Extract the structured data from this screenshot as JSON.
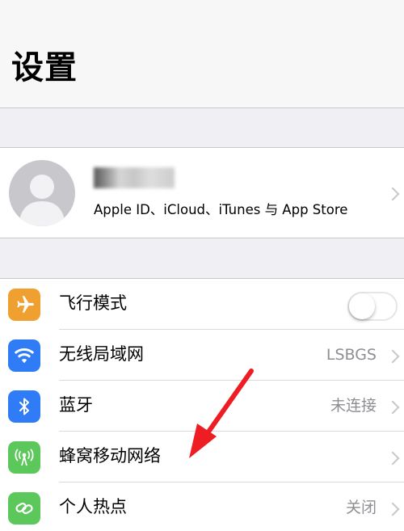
{
  "header": {
    "title": "设置"
  },
  "profile": {
    "name_redacted": "",
    "subtitle": "Apple ID、iCloud、iTunes 与 App Store",
    "avatar_icon": "person-silhouette-icon"
  },
  "settings": {
    "items": [
      {
        "label": "飞行模式",
        "value": "",
        "icon": "airplane-icon",
        "color": "#f0a030",
        "toggle": false
      },
      {
        "label": "无线局域网",
        "value": "LSBGS",
        "icon": "wifi-icon",
        "color": "#2f7cf6"
      },
      {
        "label": "蓝牙",
        "value": "未连接",
        "icon": "bluetooth-icon",
        "color": "#2f7cf6"
      },
      {
        "label": "蜂窝移动网络",
        "value": "",
        "icon": "cellular-antenna-icon",
        "color": "#5cc85c"
      },
      {
        "label": "个人热点",
        "value": "关闭",
        "icon": "hotspot-link-icon",
        "color": "#5cc85c"
      }
    ]
  },
  "annotation": {
    "arrow_color": "#ee1d23",
    "arrow_icon": "red-arrow-icon"
  }
}
